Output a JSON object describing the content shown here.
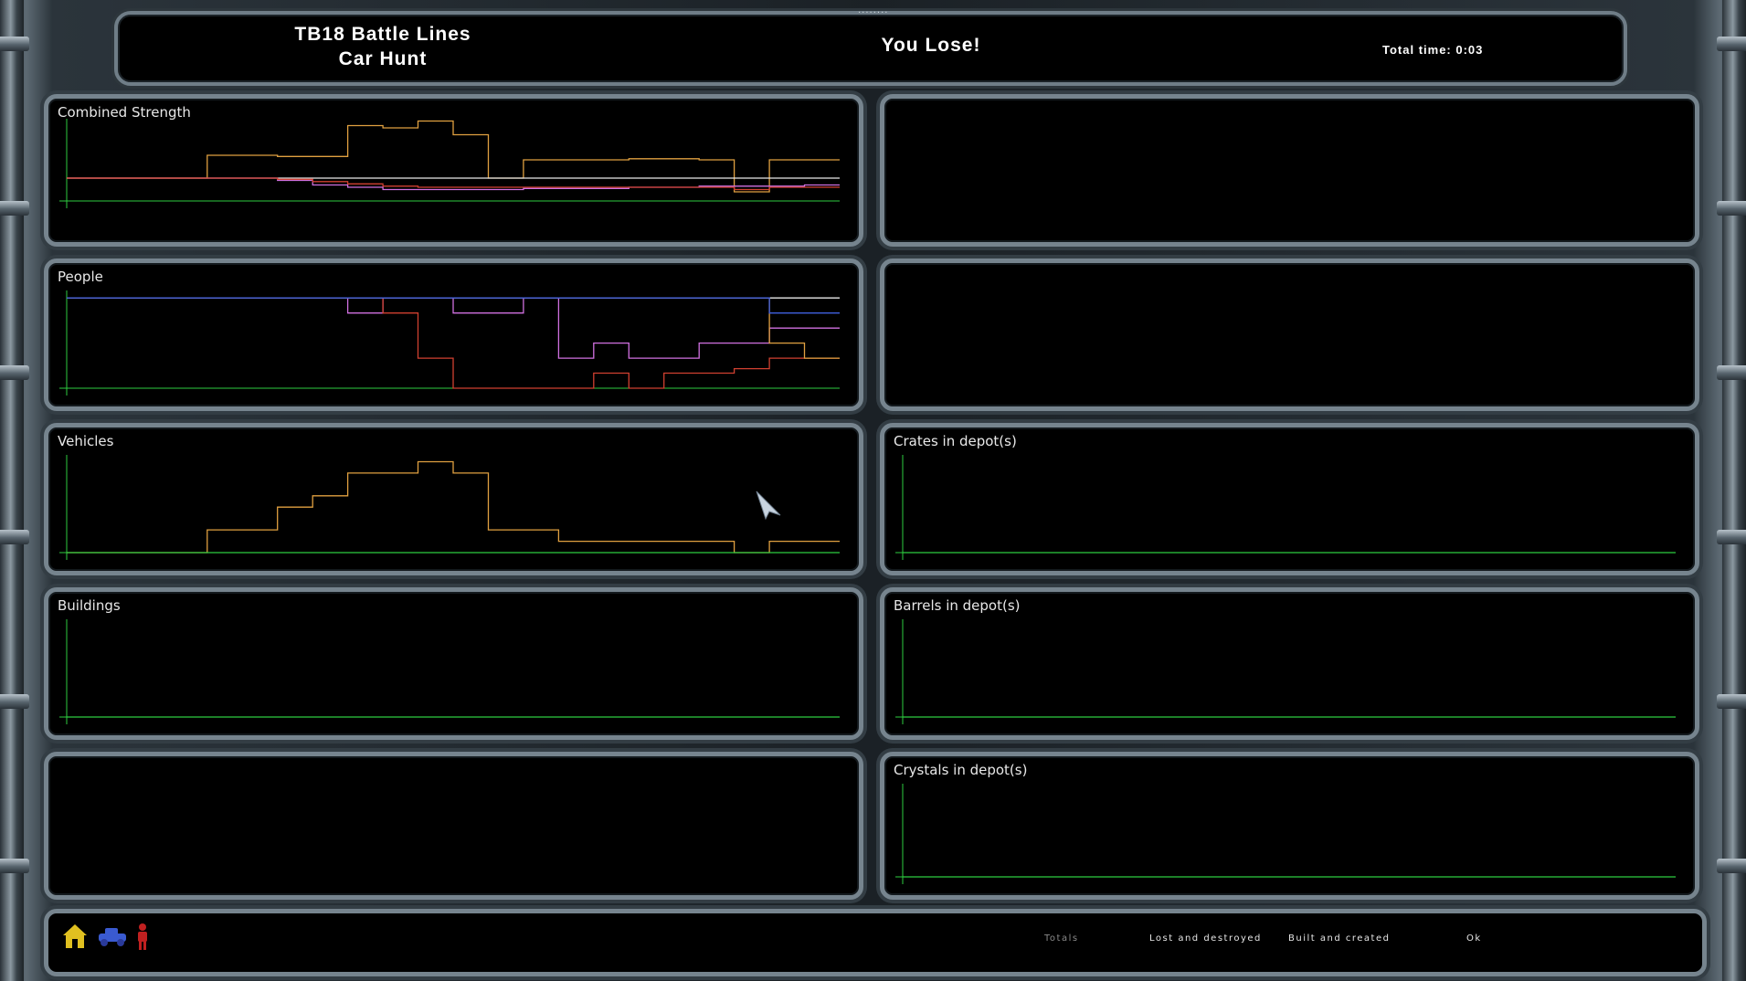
{
  "header": {
    "dots": "........",
    "title_line1": "TB18 Battle Lines",
    "title_line2": "Car Hunt",
    "result": "You Lose!",
    "total_time": "Total time: 0:03"
  },
  "panels": {
    "combined_strength": "Combined Strength",
    "people": "People",
    "vehicles": "Vehicles",
    "buildings": "Buildings",
    "crates": "Crates in depot(s)",
    "barrels": "Barrels in depot(s)",
    "crystals": "Crystals in depot(s)"
  },
  "footer": {
    "totals": "Totals",
    "lost": "Lost and destroyed",
    "built": "Built and created",
    "ok": "Ok",
    "icons": [
      "house-icon",
      "vehicle-icon",
      "person-icon"
    ]
  },
  "colors": {
    "axis": "#2ecc40",
    "orange": "#e0a040",
    "magenta": "#d070e0",
    "red": "#d04030",
    "blue": "#4060e0",
    "white": "#e8e8e8",
    "green": "#a0ff80",
    "frame": "#76848e"
  },
  "chart_data": [
    {
      "type": "line",
      "title": "Combined Strength",
      "x_steps": 22,
      "series": [
        {
          "color": "orange",
          "values": [
            0,
            0,
            0,
            0,
            1,
            1,
            0.95,
            0.95,
            2.3,
            2.2,
            2.5,
            1.9,
            0,
            0.8,
            0.8,
            0.8,
            0.85,
            0.85,
            0.8,
            -0.6,
            0.8,
            0.8
          ]
        },
        {
          "color": "white",
          "values": [
            0,
            0,
            0,
            0,
            0,
            0,
            0,
            0,
            0,
            0,
            0,
            0,
            0,
            0,
            0,
            0,
            0,
            0,
            0,
            0,
            0,
            0
          ]
        },
        {
          "color": "magenta",
          "values": [
            0,
            0,
            0,
            0,
            0,
            0,
            -0.1,
            -0.3,
            -0.4,
            -0.5,
            -0.5,
            -0.5,
            -0.5,
            -0.45,
            -0.45,
            -0.45,
            -0.4,
            -0.4,
            -0.35,
            -0.35,
            -0.35,
            -0.3
          ]
        },
        {
          "color": "red",
          "values": [
            0,
            0,
            0,
            0,
            0,
            0,
            -0.05,
            -0.15,
            -0.25,
            -0.35,
            -0.4,
            -0.4,
            -0.4,
            -0.4,
            -0.4,
            -0.4,
            -0.4,
            -0.4,
            -0.4,
            -0.5,
            -0.4,
            -0.4
          ]
        }
      ]
    },
    {
      "type": "line",
      "title": "People",
      "x_steps": 22,
      "series": [
        {
          "color": "white",
          "values": [
            6,
            6,
            6,
            6,
            6,
            6,
            6,
            6,
            6,
            6,
            6,
            6,
            6,
            6,
            6,
            6,
            6,
            6,
            6,
            6,
            6,
            6
          ]
        },
        {
          "color": "magenta",
          "values": [
            6,
            6,
            6,
            6,
            6,
            6,
            6,
            6,
            5,
            6,
            6,
            5,
            5,
            6,
            2,
            3,
            2,
            2,
            3,
            3,
            4,
            4
          ]
        },
        {
          "color": "red",
          "values": [
            6,
            6,
            6,
            6,
            6,
            6,
            6,
            6,
            6,
            5,
            2,
            0,
            0,
            0,
            0,
            1,
            0,
            1,
            1,
            1.3,
            2,
            2
          ]
        },
        {
          "color": "orange",
          "values": [
            6,
            6,
            6,
            6,
            6,
            6,
            6,
            6,
            6,
            6,
            6,
            6,
            6,
            6,
            6,
            6,
            6,
            6,
            6,
            6,
            3,
            2
          ]
        },
        {
          "color": "blue",
          "values": [
            6,
            6,
            6,
            6,
            6,
            6,
            6,
            6,
            6,
            6,
            6,
            6,
            6,
            6,
            6,
            6,
            6,
            6,
            6,
            6,
            5,
            5
          ]
        }
      ]
    },
    {
      "type": "line",
      "title": "Vehicles",
      "x_steps": 22,
      "series": [
        {
          "color": "orange",
          "values": [
            0,
            0,
            0,
            0,
            1,
            1,
            2,
            2.5,
            3.5,
            3.5,
            4,
            3.5,
            1,
            1,
            0.5,
            0.5,
            0.5,
            0.5,
            0.5,
            0,
            0.5,
            0.5
          ]
        },
        {
          "color": "axis",
          "values": [
            0,
            0,
            0,
            0,
            0,
            0,
            0,
            0,
            0,
            0,
            0,
            0,
            0,
            0,
            0,
            0,
            0,
            0,
            0,
            0,
            0,
            0
          ]
        }
      ]
    },
    {
      "type": "line",
      "title": "Buildings",
      "series": [
        {
          "color": "axis",
          "values": [
            0,
            0
          ]
        }
      ]
    },
    {
      "type": "line",
      "title": "Crates in depot(s)",
      "series": [
        {
          "color": "axis",
          "values": [
            0,
            0
          ]
        }
      ]
    },
    {
      "type": "line",
      "title": "Barrels in depot(s)",
      "series": [
        {
          "color": "axis",
          "values": [
            0,
            0
          ]
        }
      ]
    },
    {
      "type": "line",
      "title": "Crystals in depot(s)",
      "series": [
        {
          "color": "axis",
          "values": [
            0,
            0
          ]
        }
      ]
    }
  ]
}
